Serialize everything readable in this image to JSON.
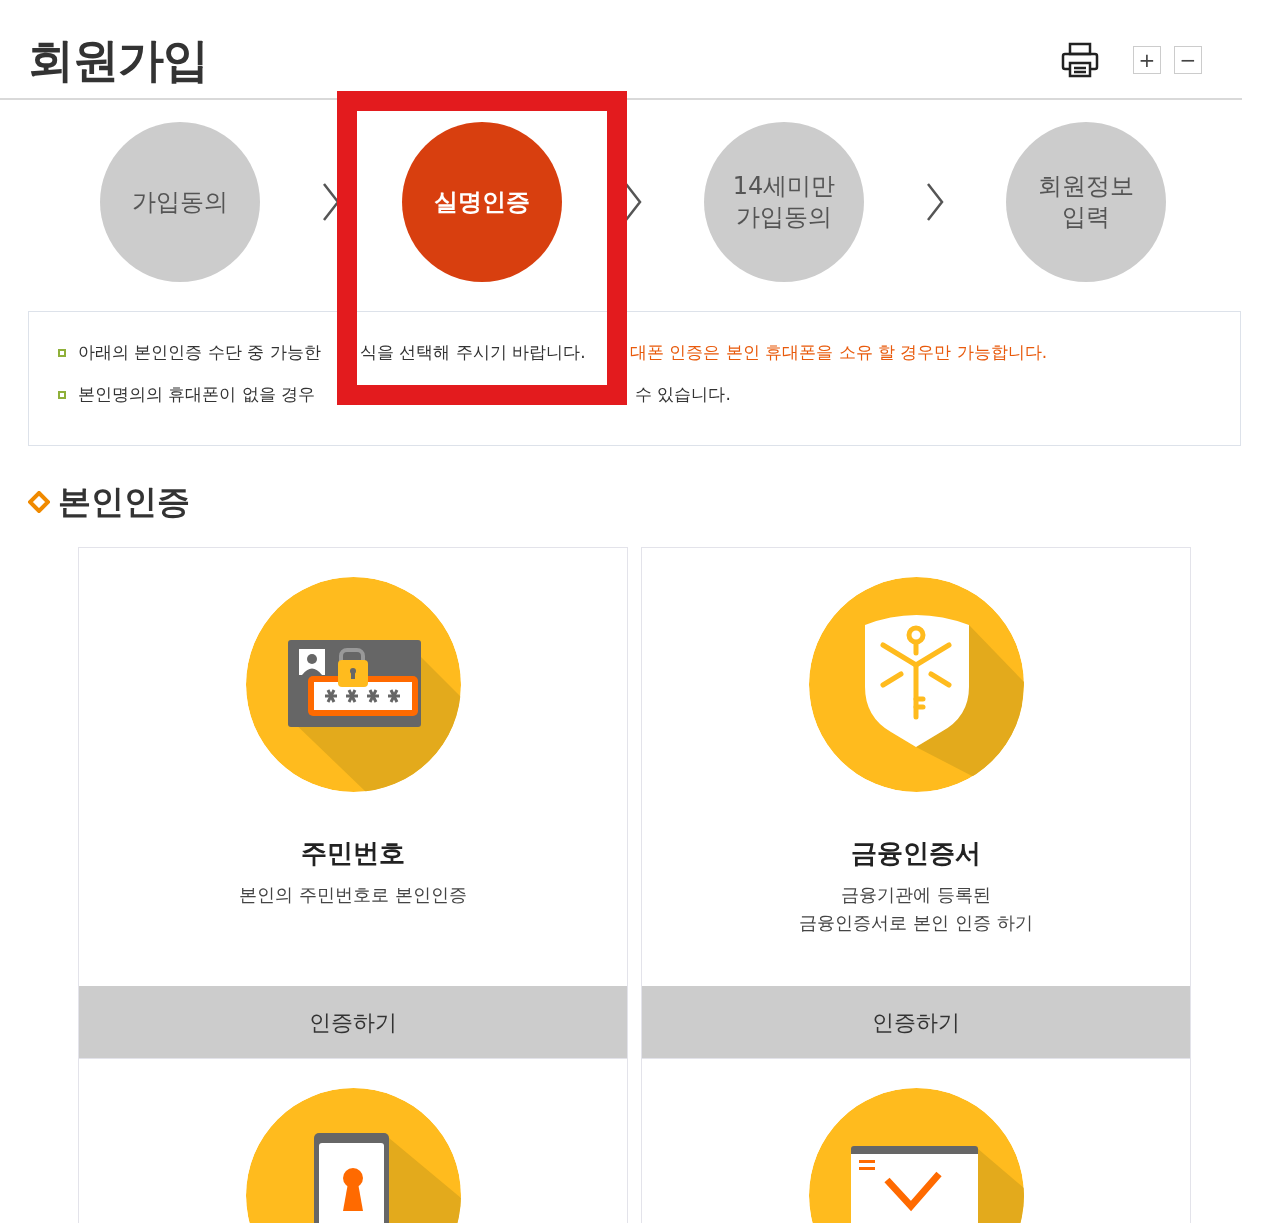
{
  "page_title": "회원가입",
  "toolbar": {
    "zoom_in": "+",
    "zoom_out": "−"
  },
  "steps": [
    {
      "label": "가입동의",
      "selected": false
    },
    {
      "label": "실명인증",
      "selected": true
    },
    {
      "label": "14세미만\n가입동의",
      "selected": false
    },
    {
      "label": "회원정보\n입력",
      "selected": false
    }
  ],
  "notices": [
    {
      "segments": [
        {
          "text": "아래의 본인인증 수단 중 가능한",
          "highlight": false
        },
        {
          "text": "식을 선택해 주시기 바랍니다.",
          "highlight": false
        },
        {
          "text": "대폰 인증은 본인 휴대폰을 소유 할 경우만 가능합니다.",
          "highlight": true
        }
      ]
    },
    {
      "segments": [
        {
          "text": "본인명의의 휴대폰이 없을 경우",
          "highlight": false
        },
        {
          "text": "수 있습니다.",
          "highlight": false
        }
      ]
    }
  ],
  "section_title": "본인인증",
  "methods": [
    {
      "kind": "id-card",
      "title": "주민번호",
      "description": "본인의 주민번호로 본인인증",
      "button": "인증하기"
    },
    {
      "kind": "certificate",
      "title": "금융인증서",
      "description": "금융기관에 등록된\n금융인증서로 본인 인증 하기",
      "button": "인증하기"
    },
    {
      "kind": "phone"
    },
    {
      "kind": "check-window"
    }
  ]
}
